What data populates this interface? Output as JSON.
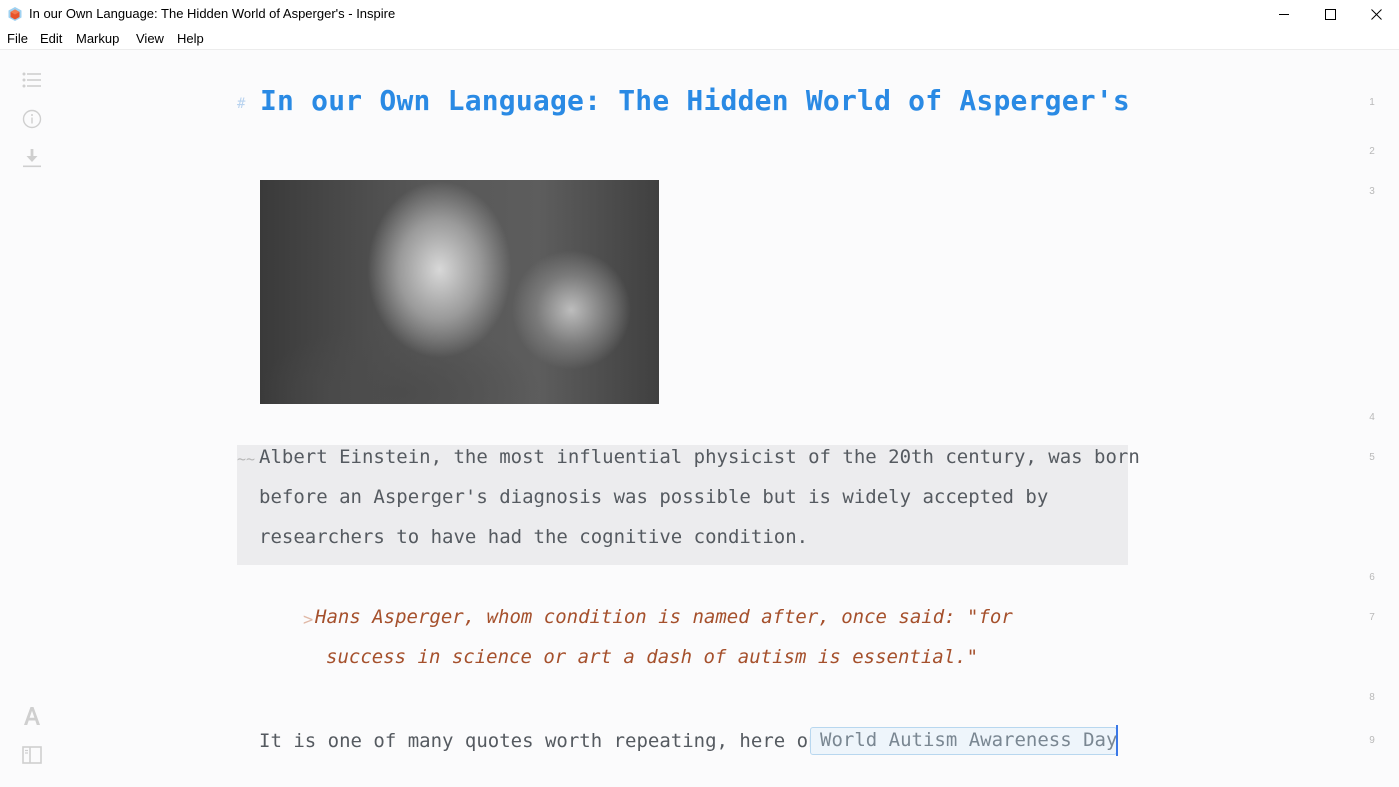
{
  "window": {
    "title": "In our Own Language: The Hidden World of Asperger's - Inspire",
    "app_icon": "inspire-cube-icon",
    "controls": [
      "minimize-icon",
      "maximize-icon",
      "close-icon"
    ]
  },
  "menubar": {
    "items": [
      {
        "label": "File"
      },
      {
        "label": "Edit"
      },
      {
        "label": "Markup"
      },
      {
        "label": "View"
      },
      {
        "label": "Help"
      }
    ]
  },
  "sidebar": {
    "top_icons": [
      "outline-list-icon",
      "info-icon",
      "export-download-icon"
    ],
    "bottom_icons": [
      "font-typography-icon",
      "sidebar-layout-icon"
    ]
  },
  "document": {
    "heading_marker": "#",
    "heading": "In our Own Language: The Hidden World of Asperger's",
    "image_alt": "Black and white portrait of Albert Einstein with hands clasped",
    "paragraph_marker": "~~",
    "paragraph_lines": [
      "Albert Einstein, the most influential physicist of the 20th century, was born",
      "before an Asperger's diagnosis was possible but is widely accepted by",
      "researchers to have had the cognitive condition."
    ],
    "quote_marker": ">",
    "quote_lines": [
      "Hans Asperger, whom condition is named after, once said: \"for",
      "success in science or art a dash of autism is essential.\""
    ],
    "last_line": "It is one of many quotes worth repeating, here on",
    "link_text": "World Autism Awareness Day"
  },
  "line_numbers": [
    "1",
    "2",
    "3",
    "4",
    "5",
    "6",
    "7",
    "8",
    "9"
  ],
  "colors": {
    "heading": "#2a8ae4",
    "quote": "#a5502c",
    "body_text": "#555a60",
    "highlight_block": "#ececee",
    "caret": "#3b78e7"
  }
}
